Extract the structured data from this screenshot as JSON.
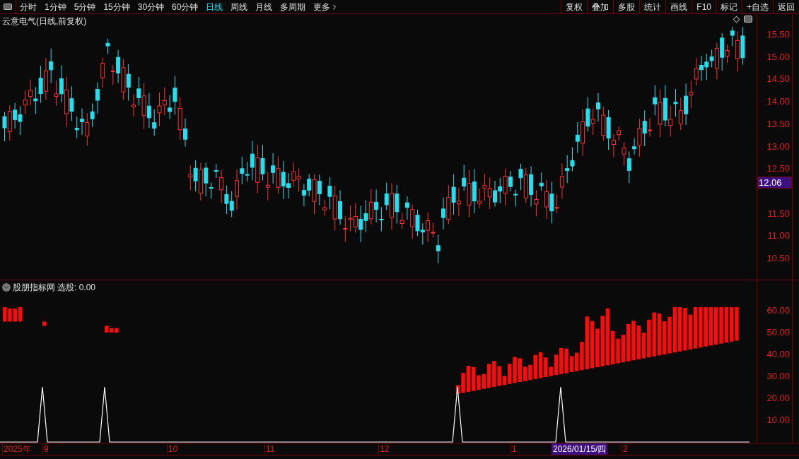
{
  "toolbar": {
    "periods": [
      {
        "label": "分时",
        "selected": false
      },
      {
        "label": "1分钟",
        "selected": false
      },
      {
        "label": "5分钟",
        "selected": false
      },
      {
        "label": "15分钟",
        "selected": false
      },
      {
        "label": "30分钟",
        "selected": false
      },
      {
        "label": "60分钟",
        "selected": false
      },
      {
        "label": "日线",
        "selected": true
      },
      {
        "label": "周线",
        "selected": false
      },
      {
        "label": "月线",
        "selected": false
      },
      {
        "label": "多周期",
        "selected": false
      },
      {
        "label": "更多",
        "selected": false
      }
    ],
    "buttons": [
      "复权",
      "叠加",
      "多股",
      "统计",
      "画线",
      "F10",
      "标记",
      "+自选",
      "返回"
    ]
  },
  "chart": {
    "title": "云意电气(日线,前复权)",
    "price_ticks": [
      "15.50",
      "15.00",
      "14.50",
      "14.00",
      "13.50",
      "13.00",
      "12.50",
      "11.50",
      "11.00",
      "10.50"
    ],
    "current_price": "12.06"
  },
  "indicator": {
    "name": "股朋指标网",
    "label": "选股:",
    "value": "0.00",
    "ticks": [
      "60.00",
      "50.00",
      "40.00",
      "30.00",
      "20.00",
      "10.00"
    ]
  },
  "date_axis": {
    "labels": [
      "2025年",
      "9",
      "10",
      "11",
      "12",
      "1",
      "2"
    ],
    "cursor_date": "2026/01/15/四"
  }
}
